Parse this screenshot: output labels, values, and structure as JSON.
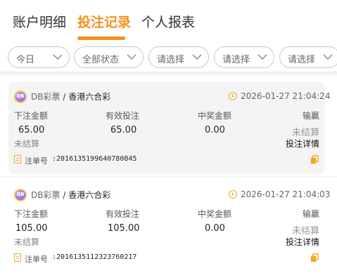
{
  "tabs": [
    {
      "label": "账户明细",
      "active": false
    },
    {
      "label": "投注记录",
      "active": true
    },
    {
      "label": "个人报表",
      "active": false
    }
  ],
  "filters": [
    {
      "value": "今日"
    },
    {
      "value": "全部状态"
    },
    {
      "value": "请选择"
    },
    {
      "value": "请选择"
    },
    {
      "value": "请选择"
    }
  ],
  "columns": {
    "bet_amount": "下注金额",
    "valid_bet": "有效投注",
    "win_amount": "中奖金额",
    "win_loss": "输赢"
  },
  "labels": {
    "order_no": "注单号",
    "bet_detail": "投注详情",
    "separator": "/"
  },
  "records": [
    {
      "provider": "DB彩票",
      "game": "香港六合彩",
      "time": "2026-01-27 21:04:24",
      "bet_amount": "65.00",
      "valid_bet": "65.00",
      "win_amount": "0.00",
      "status": "未结算",
      "result": "未结算",
      "order_no": ":2016135199640780845"
    },
    {
      "provider": "DB彩票",
      "game": "香港六合彩",
      "time": "2026-01-27 21:04:03",
      "bet_amount": "105.00",
      "valid_bet": "105.00",
      "win_amount": "0.00",
      "status": "未结算",
      "result": "未结算",
      "order_no": ":2016135112323760217"
    }
  ],
  "colors": {
    "accent": "#f5921e",
    "icon_accent": "#f5a623",
    "card_highlight": "#f4f4f4"
  },
  "icons": [
    "chevron-down-icon",
    "lottery-game-icon",
    "clock-icon",
    "clipboard-icon",
    "copy-icon"
  ]
}
